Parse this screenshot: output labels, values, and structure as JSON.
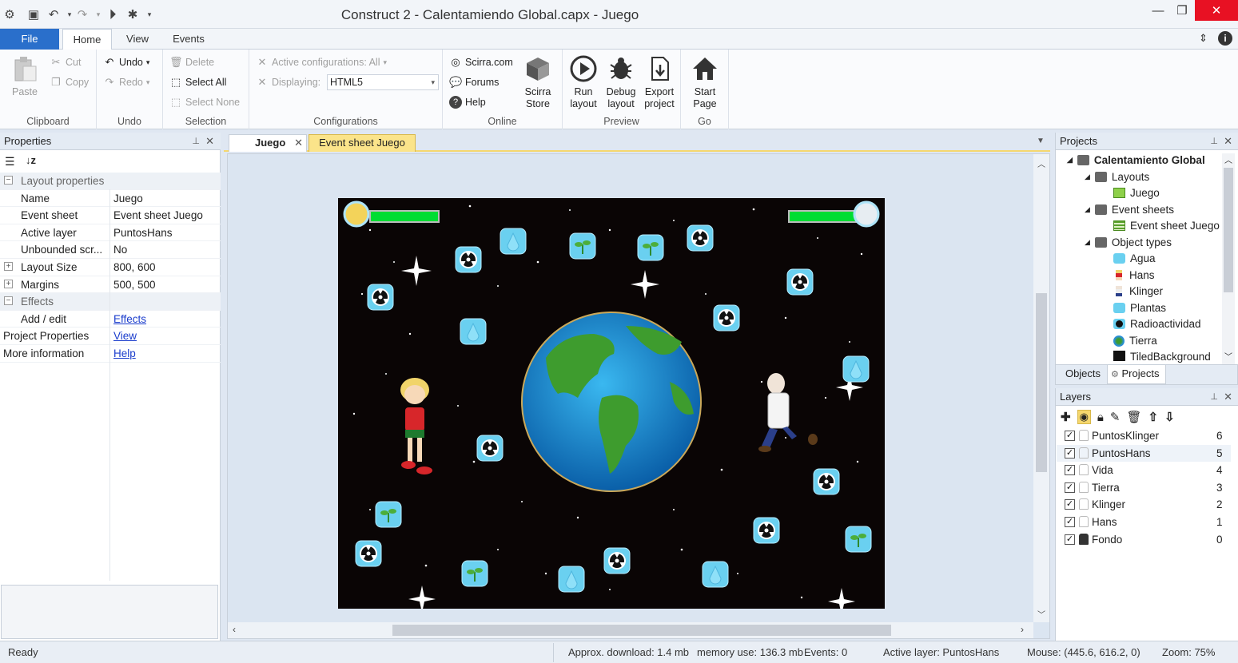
{
  "window": {
    "title": "Construct 2 - Calentamiendo Global.capx - Juego",
    "controls": [
      "—",
      "❐",
      "✕"
    ]
  },
  "ribbon_tabs": [
    "File",
    "Home",
    "View",
    "Events"
  ],
  "ribbon": {
    "clipboard": {
      "label": "Clipboard",
      "paste": "Paste",
      "cut": "Cut",
      "copy": "Copy"
    },
    "undo": {
      "label": "Undo",
      "undo": "Undo",
      "redo": "Redo"
    },
    "selection": {
      "label": "Selection",
      "delete": "Delete",
      "select_all": "Select All",
      "select_none": "Select None"
    },
    "configurations": {
      "label": "Configurations",
      "active": "Active configurations: All",
      "displaying_label": "Displaying:",
      "displaying_value": "HTML5"
    },
    "online": {
      "label": "Online",
      "scirra": "Scirra.com",
      "forums": "Forums",
      "help": "Help",
      "store1": "Scirra",
      "store2": "Store"
    },
    "preview": {
      "label": "Preview",
      "run1": "Run",
      "run2": "layout",
      "debug1": "Debug",
      "debug2": "layout",
      "export1": "Export",
      "export2": "project"
    },
    "go": {
      "label": "Go",
      "start1": "Start",
      "start2": "Page"
    }
  },
  "properties": {
    "header": "Properties",
    "layout_section": "Layout properties",
    "rows": [
      {
        "key": "Name",
        "value": "Juego"
      },
      {
        "key": "Event sheet",
        "value": "Event sheet Juego"
      },
      {
        "key": "Active layer",
        "value": "PuntosHans"
      },
      {
        "key": "Unbounded scr...",
        "value": "No"
      },
      {
        "key": "Layout Size",
        "value": "800, 600"
      },
      {
        "key": "Margins",
        "value": "500, 500"
      }
    ],
    "effects_section": "Effects",
    "add_edit": "Add / edit",
    "effects_link": "Effects",
    "project_properties": "Project Properties",
    "view_link": "View",
    "more_information": "More information",
    "help_link": "Help"
  },
  "doc_tabs": {
    "juego": "Juego",
    "eventsheet": "Event sheet Juego"
  },
  "projects": {
    "header": "Projects",
    "root": "Calentamiento Global",
    "layouts": "Layouts",
    "layout_juego": "Juego",
    "event_sheets": "Event sheets",
    "event_sheet_juego": "Event sheet Juego",
    "object_types": "Object types",
    "objects": [
      "Agua",
      "Hans",
      "Klinger",
      "Plantas",
      "Radioactividad",
      "Tierra",
      "TiledBackground"
    ],
    "tab_objects": "Objects",
    "tab_projects": "Projects"
  },
  "layers": {
    "header": "Layers",
    "items": [
      {
        "name": "PuntosKlinger",
        "num": "6"
      },
      {
        "name": "PuntosHans",
        "num": "5"
      },
      {
        "name": "Vida",
        "num": "4"
      },
      {
        "name": "Tierra",
        "num": "3"
      },
      {
        "name": "Klinger",
        "num": "2"
      },
      {
        "name": "Hans",
        "num": "1"
      },
      {
        "name": "Fondo",
        "num": "0"
      }
    ]
  },
  "status": {
    "ready": "Ready",
    "download": "Approx. download: 1.4 mb",
    "memory": "memory use: 136.3 mb",
    "events": "Events: 0",
    "active_layer": "Active layer: PuntosHans",
    "mouse": "Mouse: (445.6, 616.2, 0)",
    "zoom": "Zoom: 75%"
  },
  "colors": {
    "accent": "#2a6fcb",
    "tab_highlight": "#fbe48a",
    "scene_bg": "#0a0505"
  }
}
